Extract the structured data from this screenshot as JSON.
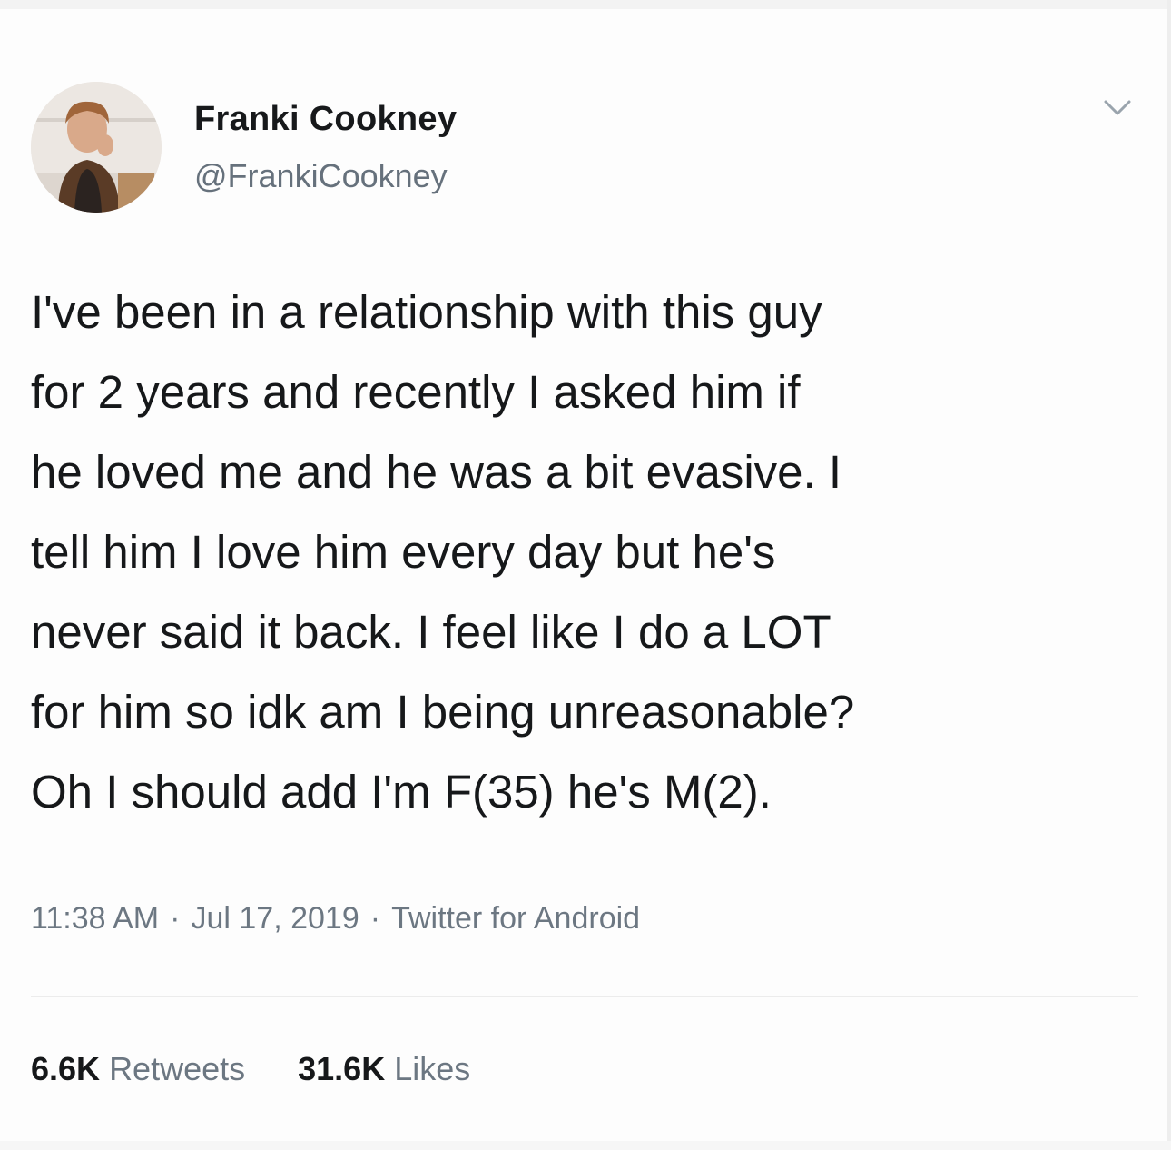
{
  "author": {
    "display_name": "Franki Cookney",
    "handle": "@FrankiCookney"
  },
  "tweet": {
    "lines": [
      "I've been in a relationship with this guy",
      "for 2 years and recently I asked him if",
      "he loved me and he was a bit evasive. I",
      "tell him I love him every day but he's",
      "never said it back. I feel like I do a LOT",
      "for him so idk am I being unreasonable?",
      "Oh I should add I'm F(35) he's M(2)."
    ],
    "time": "11:38 AM",
    "date": "Jul 17, 2019",
    "separator": "·",
    "source": "Twitter for Android"
  },
  "stats": {
    "retweets_count": "6.6K",
    "retweets_label": "Retweets",
    "likes_count": "31.6K",
    "likes_label": "Likes"
  },
  "icons": {
    "menu": "chevron-down-icon",
    "avatar": "user-avatar"
  },
  "colors": {
    "background": "#fdfdfd",
    "text_primary": "#16181a",
    "text_secondary": "#66717c"
  }
}
